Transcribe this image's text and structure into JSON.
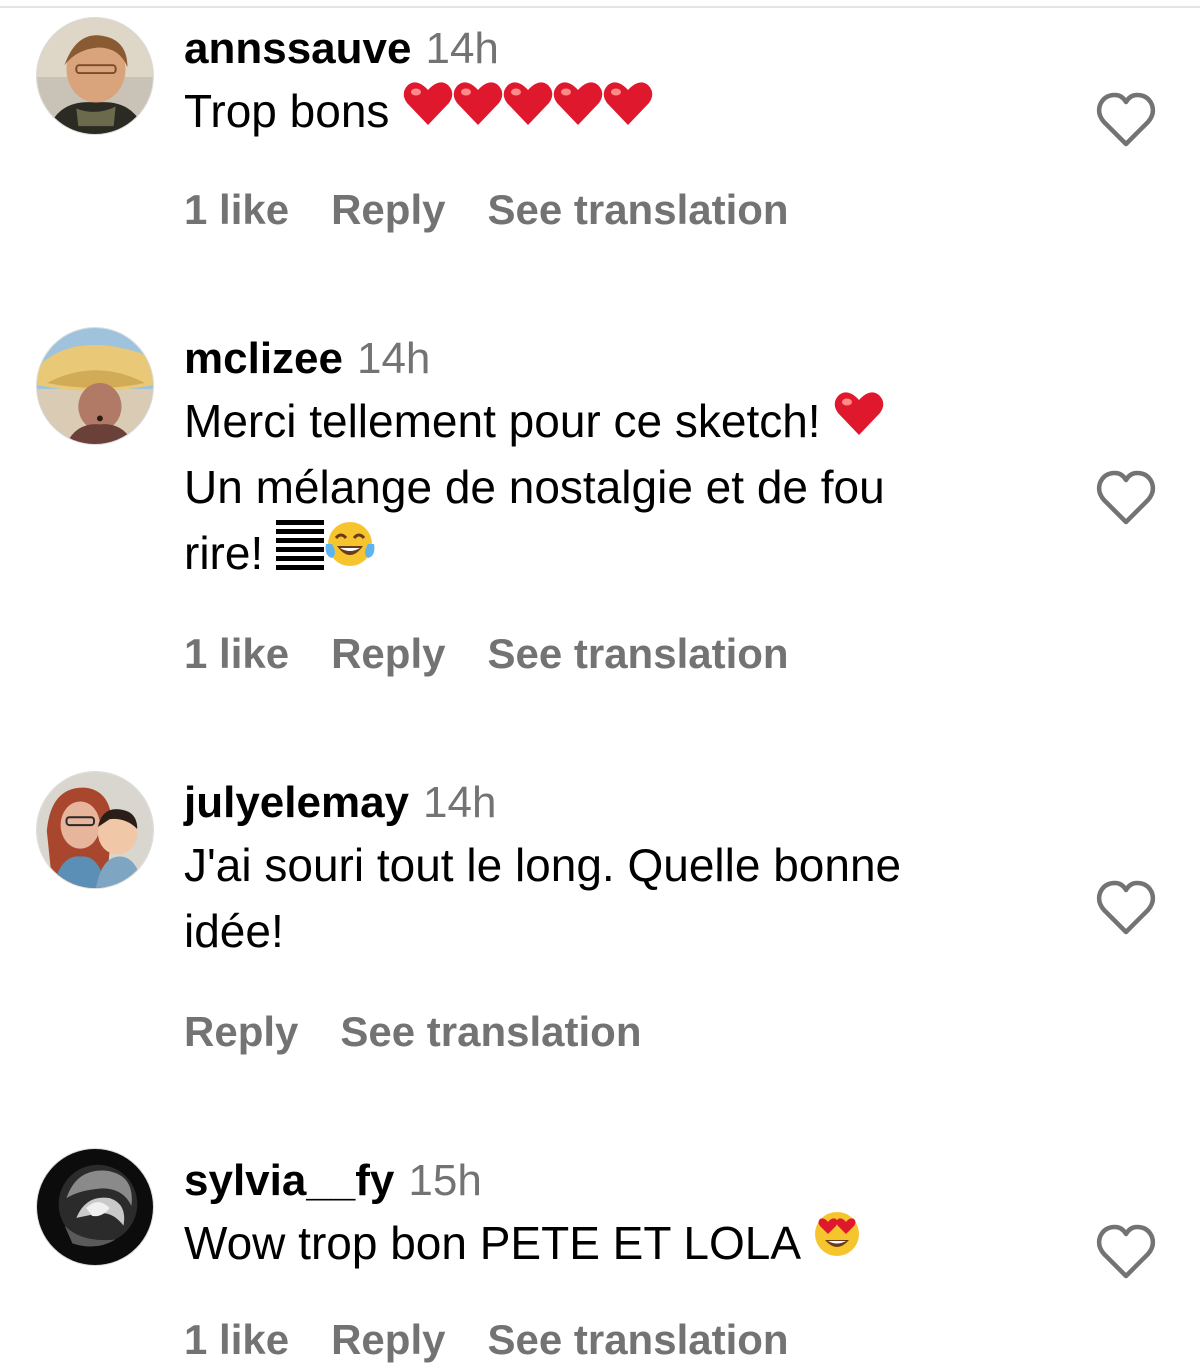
{
  "colors": {
    "text": "#000000",
    "muted": "#737373",
    "heart_emoji": "#e0182d",
    "laugh_emoji": "#f6c52e"
  },
  "comments": [
    {
      "username": "annssauve",
      "time": "14h",
      "text": "Trop bons",
      "emoji": [
        "red-heart",
        "red-heart",
        "red-heart",
        "red-heart",
        "red-heart"
      ],
      "like_count": "1 like",
      "reply_label": "Reply",
      "translate_label": "See translation"
    },
    {
      "username": "mclizee",
      "time": "14h",
      "text_line1": "Merci tellement pour ce sketch!",
      "text_line2": "Un mélange de nostalgie et de fou",
      "text_line3": "rire!",
      "emoji": [
        "red-heart",
        "unknown-glyph",
        "tears-of-joy"
      ],
      "like_count": "1 like",
      "reply_label": "Reply",
      "translate_label": "See translation"
    },
    {
      "username": "julyelemay",
      "time": "14h",
      "text_line1": "J'ai souri tout le long. Quelle bonne",
      "text_line2": "idée!",
      "reply_label": "Reply",
      "translate_label": "See translation"
    },
    {
      "username": "sylvia__fy",
      "time": "15h",
      "text": "Wow trop bon PETE ET LOLA",
      "emoji": [
        "heart-eyes"
      ],
      "like_count": "1 like",
      "reply_label": "Reply",
      "translate_label": "See translation"
    }
  ]
}
